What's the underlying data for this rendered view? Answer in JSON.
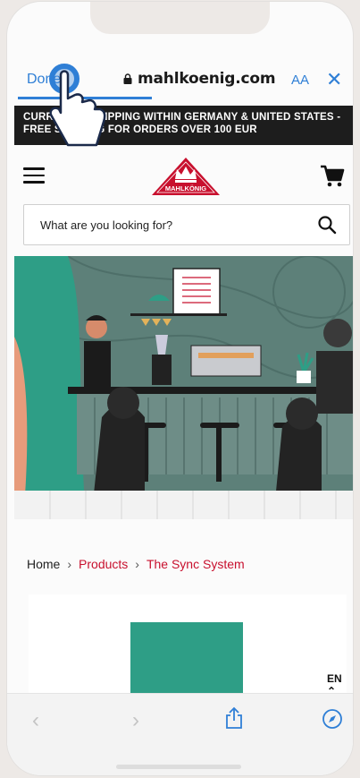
{
  "browser": {
    "done_label": "Done",
    "url": "mahlkoenig.com",
    "text_size_label": "AA",
    "close_label": "✕"
  },
  "banner": {
    "text": "CURRENTLY SHIPPING WITHIN GERMANY & UNITED STATES - FREE SHIPPING FOR ORDERS OVER 100 EUR"
  },
  "header": {
    "logo_text": "MAHLKÖNIG"
  },
  "search": {
    "placeholder": "What are you looking for?"
  },
  "breadcrumb": {
    "home": "Home",
    "products": "Products",
    "current": "The Sync System"
  },
  "language": {
    "code": "EN ⌃"
  },
  "colors": {
    "accent": "#2f7fd6",
    "brand_red": "#c8102e",
    "teal": "#2e9e86",
    "banner_bg": "#1d1d1d"
  }
}
